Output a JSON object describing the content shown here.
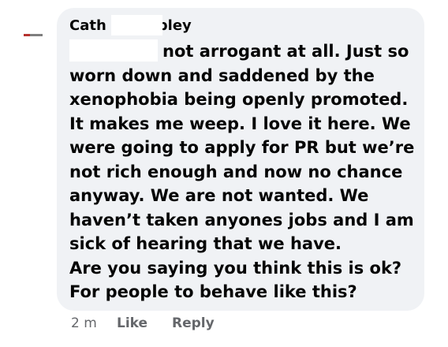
{
  "comment": {
    "author_start": "Cath",
    "author_end": "bley",
    "lines": [
      "not arrogant at all. Just so",
      "worn down and saddened by the",
      "xenophobia being openly promoted.",
      "It makes me weep. I love it here. We",
      "were going to apply for PR but we’re",
      "not rich enough and now no chance",
      "anyway. We are not wanted. We",
      "haven’t taken anyones jobs and I am",
      "sick of hearing that we have.",
      "Are you saying you think this is ok?",
      "For people to behave like this?"
    ],
    "timestamp": "2 m",
    "like_label": "Like",
    "reply_label": "Reply"
  },
  "colors": {
    "bubble": "#f0f2f5",
    "text": "#050505",
    "muted": "#65676b",
    "redaction": "#ffffff"
  },
  "icons": {
    "avatar": "avatar-icon"
  }
}
